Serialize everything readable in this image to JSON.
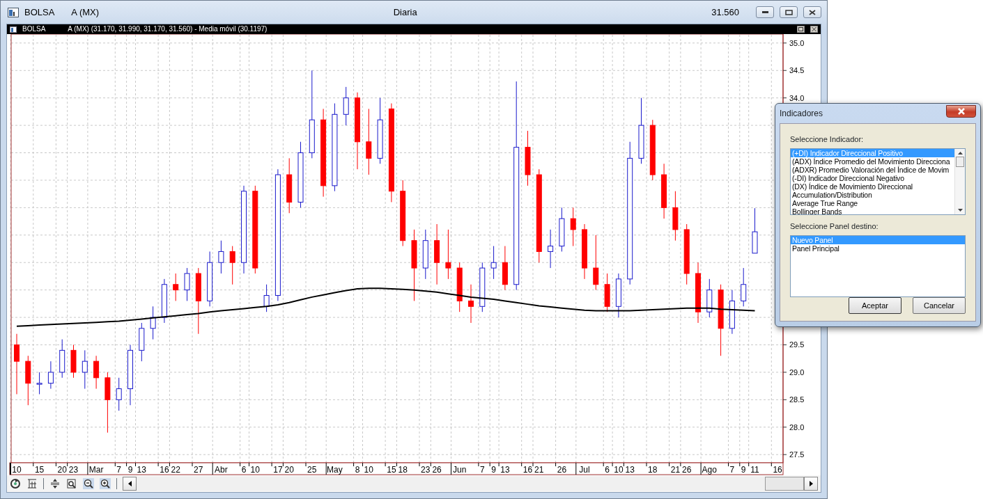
{
  "window": {
    "symbol": "BOLSA",
    "instrument": "A (MX)",
    "period": "Diaria",
    "price": "31.560"
  },
  "chart": {
    "header_symbol": "BOLSA",
    "header_quote": "A (MX) (31.170, 31.990, 31.170, 31.560) -",
    "indicator_value": "(30.1197)",
    "chart_data": {
      "type": "candlestick",
      "grid": true,
      "ylim": [
        27.35,
        35.15
      ],
      "categories": [
        "10",
        null,
        "15",
        null,
        "20",
        "23",
        null,
        "Mar",
        null,
        "7",
        "9",
        "13",
        null,
        "16",
        "22",
        null,
        "27",
        null,
        "Abr",
        null,
        "6",
        "10",
        null,
        "17",
        "20",
        null,
        "25",
        null,
        "May",
        null,
        "8",
        "10",
        null,
        "15",
        "18",
        null,
        "23",
        "26",
        null,
        "Jun",
        null,
        "7",
        "9",
        "13",
        null,
        "16",
        "21",
        null,
        "26",
        null,
        "Jul",
        null,
        "6",
        "10",
        "13",
        null,
        "18",
        null,
        "21",
        "26",
        null,
        "Ago",
        null,
        "7",
        "9",
        "11",
        null,
        "16"
      ],
      "yticks": [
        {
          "value": 35,
          "label": "35.0"
        },
        34.5,
        {
          "value": 34,
          "label": "34.0"
        },
        29.5,
        {
          "value": 29,
          "label": "29.0"
        },
        28.5,
        {
          "value": 28,
          "label": "28.0"
        },
        27.5
      ],
      "series": [
        {
          "name": "Media móvil",
          "type": "line",
          "color": "#000000",
          "values": [
            29.84,
            29.85,
            29.86,
            29.87,
            29.88,
            29.89,
            29.9,
            29.91,
            29.92,
            29.93,
            29.95,
            29.97,
            29.99,
            30.01,
            30.03,
            30.05,
            30.07,
            30.1,
            30.12,
            30.14,
            30.16,
            30.18,
            30.2,
            30.23,
            30.27,
            30.32,
            30.37,
            30.41,
            30.45,
            30.49,
            30.52,
            30.53,
            30.53,
            30.52,
            30.51,
            30.5,
            30.48,
            30.46,
            30.43,
            30.4,
            30.37,
            30.35,
            30.33,
            30.3,
            30.27,
            30.24,
            30.21,
            30.19,
            30.17,
            30.15,
            30.13,
            30.12,
            30.12,
            30.12,
            30.12,
            30.13,
            30.14,
            30.15,
            30.16,
            30.17,
            30.17,
            30.17,
            30.15,
            30.14,
            30.13,
            30.12,
            null,
            null
          ]
        }
      ],
      "ohlc": [
        [
          29.5,
          29.7,
          28.6,
          29.2
        ],
        [
          29.2,
          29.3,
          28.4,
          28.8
        ],
        [
          28.8,
          29.0,
          28.6,
          28.8
        ],
        [
          28.8,
          29.2,
          28.7,
          29.0
        ],
        [
          29.0,
          29.6,
          28.9,
          29.4
        ],
        [
          29.4,
          29.5,
          28.9,
          29.0
        ],
        [
          29.0,
          29.4,
          28.7,
          29.2
        ],
        [
          29.2,
          29.3,
          28.7,
          28.9
        ],
        [
          28.9,
          29.0,
          27.9,
          28.5
        ],
        [
          28.5,
          28.9,
          28.3,
          28.7
        ],
        [
          28.7,
          29.5,
          28.4,
          29.4
        ],
        [
          29.4,
          29.9,
          29.2,
          29.8
        ],
        [
          29.8,
          30.2,
          29.6,
          30.0
        ],
        [
          30.0,
          30.7,
          29.9,
          30.6
        ],
        [
          30.6,
          30.8,
          30.3,
          30.5
        ],
        [
          30.5,
          30.9,
          30.3,
          30.8
        ],
        [
          30.8,
          30.9,
          29.7,
          30.3
        ],
        [
          30.3,
          31.2,
          30.2,
          31.0
        ],
        [
          31.0,
          31.4,
          30.8,
          31.2
        ],
        [
          31.2,
          31.3,
          30.6,
          31.0
        ],
        [
          31.0,
          32.4,
          30.8,
          32.3
        ],
        [
          32.3,
          32.4,
          30.8,
          30.9
        ],
        [
          30.2,
          30.6,
          30.1,
          30.4
        ],
        [
          30.4,
          32.7,
          30.3,
          32.6
        ],
        [
          32.6,
          32.9,
          31.9,
          32.1
        ],
        [
          32.1,
          33.2,
          32.0,
          33.0
        ],
        [
          33.0,
          34.5,
          32.9,
          33.6
        ],
        [
          33.6,
          33.8,
          32.2,
          32.4
        ],
        [
          32.4,
          33.9,
          32.3,
          33.7
        ],
        [
          33.7,
          34.2,
          33.5,
          34.0
        ],
        [
          34.0,
          34.1,
          32.7,
          33.2
        ],
        [
          33.2,
          33.8,
          32.6,
          32.9
        ],
        [
          32.9,
          34.0,
          32.8,
          33.6
        ],
        [
          33.8,
          33.9,
          32.1,
          32.3
        ],
        [
          32.3,
          32.5,
          31.3,
          31.4
        ],
        [
          31.4,
          31.6,
          30.3,
          30.9
        ],
        [
          30.9,
          31.6,
          30.7,
          31.4
        ],
        [
          31.4,
          31.7,
          30.6,
          31.0
        ],
        [
          31.0,
          31.6,
          30.7,
          30.9
        ],
        [
          30.9,
          31.0,
          30.1,
          30.3
        ],
        [
          30.3,
          30.6,
          29.9,
          30.2
        ],
        [
          30.2,
          31.0,
          30.1,
          30.9
        ],
        [
          30.9,
          31.3,
          30.7,
          31.0
        ],
        [
          31.0,
          31.3,
          30.5,
          30.6
        ],
        [
          30.6,
          34.3,
          30.5,
          33.1
        ],
        [
          33.1,
          33.4,
          32.4,
          32.6
        ],
        [
          32.6,
          32.7,
          31.0,
          31.2
        ],
        [
          31.2,
          31.6,
          30.9,
          31.3
        ],
        [
          31.3,
          32.0,
          31.2,
          31.8
        ],
        [
          31.8,
          32.0,
          31.3,
          31.6
        ],
        [
          31.6,
          31.7,
          30.7,
          30.9
        ],
        [
          30.9,
          31.5,
          30.5,
          30.6
        ],
        [
          30.6,
          30.8,
          30.1,
          30.2
        ],
        [
          30.2,
          30.8,
          30.0,
          30.7
        ],
        [
          30.7,
          33.2,
          30.6,
          32.9
        ],
        [
          32.9,
          34.0,
          32.8,
          33.5
        ],
        [
          33.5,
          33.6,
          32.5,
          32.6
        ],
        [
          32.6,
          32.8,
          31.8,
          32.0
        ],
        [
          32.0,
          32.3,
          31.4,
          31.6
        ],
        [
          31.6,
          31.7,
          30.6,
          30.8
        ],
        [
          30.8,
          31.0,
          29.9,
          30.1
        ],
        [
          30.1,
          30.7,
          30.0,
          30.5
        ],
        [
          30.5,
          30.6,
          29.3,
          29.8
        ],
        [
          29.8,
          30.5,
          29.7,
          30.3
        ],
        [
          30.3,
          30.9,
          30.2,
          30.6
        ],
        [
          31.17,
          31.99,
          31.17,
          31.56
        ],
        null,
        null
      ]
    }
  },
  "dialog": {
    "title": "Indicadores",
    "indicator_label": "Seleccione Indicador:",
    "indicators": [
      {
        "label": "(+DI) Indicador Direccional Positivo",
        "selected": true
      },
      {
        "label": "(ADX) Índice Promedio del Movimiento Direcciona",
        "selected": false
      },
      {
        "label": "(ADXR) Promedio Valoración del Índice de Movim",
        "selected": false
      },
      {
        "label": "(-DI) Indicador Direccional Negativo",
        "selected": false
      },
      {
        "label": "(DX) Índice de Movimiento Direccional",
        "selected": false
      },
      {
        "label": "Accumulation/Distribution",
        "selected": false
      },
      {
        "label": "Average True Range",
        "selected": false
      },
      {
        "label": "Bollinger Bands",
        "selected": false
      }
    ],
    "panel_label": "Seleccione Panel destino:",
    "panels": [
      {
        "label": "Nuevo Panel",
        "selected": true
      },
      {
        "label": "Panel Principal",
        "selected": false
      }
    ],
    "buttons": [
      "Aceptar",
      "Cancelar"
    ]
  }
}
